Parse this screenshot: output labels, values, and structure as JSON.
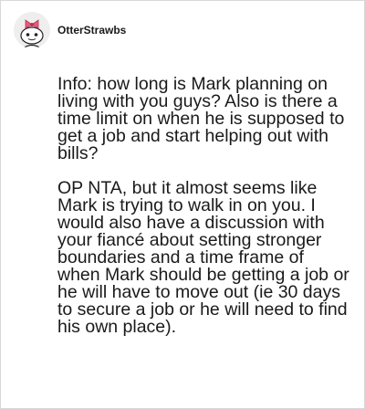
{
  "post": {
    "username": "OtterStrawbs",
    "avatar_icon": "snoo-avatar-icon",
    "paragraphs": [
      "Info: how long is Mark planning on living with you guys? Also is there a time limit on when he is supposed to get a job and start helping out with bills?",
      "OP NTA, but it almost seems like Mark is trying to walk in on you. I would also have a discussion with your fiancé about setting stronger boundaries and a time frame of when Mark should be getting a job or he will have to move out (ie 30 days to secure a job or he will need to find his own place)."
    ]
  },
  "colors": {
    "text": "#1a1a1b",
    "avatar_bg": "#eeeeee",
    "bow": "#e85a7a",
    "border": "#d8d8d8"
  }
}
